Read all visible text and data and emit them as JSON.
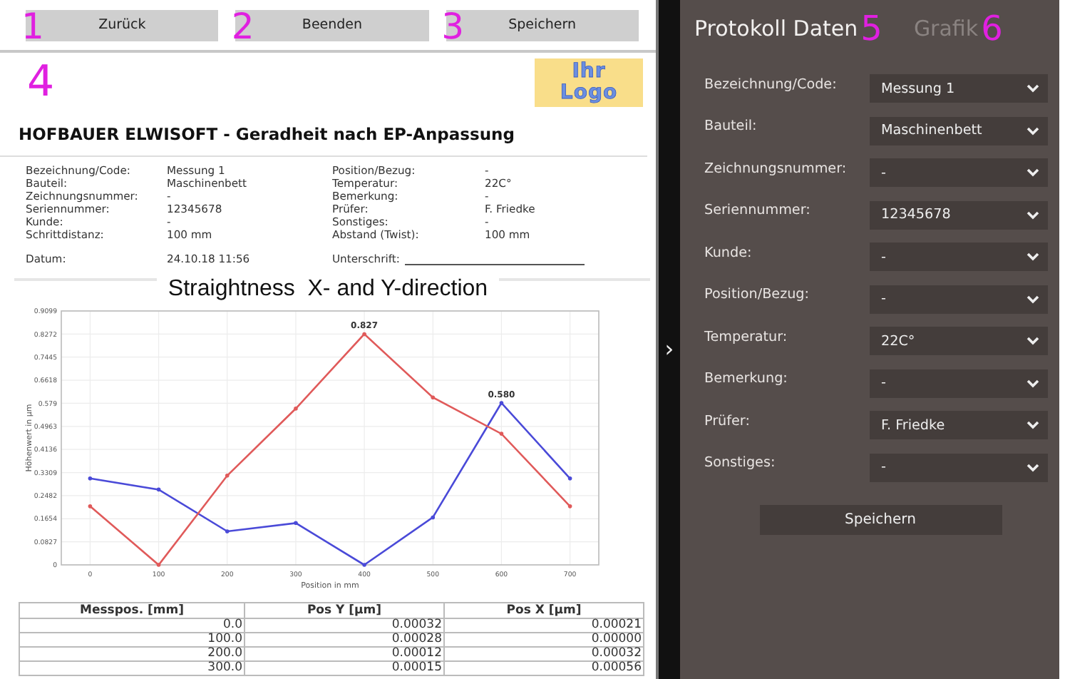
{
  "toolbar": {
    "buttons": [
      {
        "callout": "1",
        "label": "Zurück"
      },
      {
        "callout": "2",
        "label": "Beenden"
      },
      {
        "callout": "3",
        "label": "Speichern"
      }
    ]
  },
  "report": {
    "callout": "4",
    "logo": {
      "line_1": "Ihr",
      "line_2": "Logo"
    },
    "title": "HOFBAUER ELWISOFT - Geradheit nach EP-Anpassung",
    "fields_left": [
      {
        "label": "Bezeichnung/Code:",
        "value": "Messung 1"
      },
      {
        "label": "Bauteil:",
        "value": "Maschinenbett"
      },
      {
        "label": "Zeichnungsnummer:",
        "value": "-"
      },
      {
        "label": "Seriennummer:",
        "value": "12345678"
      },
      {
        "label": "Kunde:",
        "value": "-"
      },
      {
        "label": "Schrittdistanz:",
        "value": "100 mm"
      }
    ],
    "fields_right": [
      {
        "label": "Position/Bezug:",
        "value": "-"
      },
      {
        "label": "Temperatur:",
        "value": "22C°"
      },
      {
        "label": "Bemerkung:",
        "value": "-"
      },
      {
        "label": "Prüfer:",
        "value": "F. Friedke"
      },
      {
        "label": "Sonstiges:",
        "value": "-"
      },
      {
        "label": "Abstand (Twist):",
        "value": "100 mm"
      }
    ],
    "date": {
      "label": "Datum:",
      "value": "24.10.18 11:56"
    },
    "signature": {
      "label": "Unterschrift:"
    },
    "chart": {
      "chart_data": {
        "type": "line",
        "title": "Straightness  X- and Y-direction",
        "xlabel": "Position in mm",
        "ylabel": "Höhenwert in µm",
        "x": [
          0,
          100,
          200,
          300,
          400,
          500,
          600,
          700
        ],
        "series": [
          {
            "color": "#4a4ad8",
            "values": [
              0.31,
              0.27,
              0.12,
              0.15,
              0,
              0.17,
              0.58,
              0.31
            ]
          },
          {
            "color": "#e05a5a",
            "values": [
              0.21,
              0,
              0.32,
              0.56,
              0.827,
              0.6,
              0.47,
              0.21
            ]
          }
        ],
        "grid": true,
        "xlim": [
          -42,
          742
        ],
        "ylim": [
          0,
          0.9099
        ],
        "xticks": [
          0,
          100,
          200,
          300,
          400,
          500,
          600,
          700
        ],
        "yticks": [
          0,
          0.0827,
          0.1654,
          0.2482,
          0.3309,
          0.4136,
          0.4963,
          0.579,
          0.6618,
          0.7445,
          0.8272,
          0.9099
        ],
        "annotations": [
          {
            "x": 400,
            "y": 0.827,
            "text": "0.827"
          },
          {
            "x": 600,
            "y": 0.58,
            "text": "0.580"
          }
        ]
      }
    },
    "table": {
      "columns": [
        "Messpos. [mm]",
        "Pos Y [µm]",
        "Pos X [µm]"
      ],
      "rows": [
        [
          "0.0",
          "0.00032",
          "0.00021"
        ],
        [
          "100.0",
          "0.00028",
          "0.00000"
        ],
        [
          "200.0",
          "0.00012",
          "0.00032"
        ],
        [
          "300.0",
          "0.00015",
          "0.00056"
        ]
      ]
    }
  },
  "side_panel": {
    "toggle": "›",
    "tabs": [
      {
        "label": "Protokoll Daten",
        "callout": "5",
        "selected": true
      },
      {
        "label": "Grafik",
        "callout": "6",
        "selected": false
      }
    ],
    "fields": [
      {
        "label": "Bezeichnung/Code:",
        "value": "Messung 1"
      },
      {
        "label": "Bauteil:",
        "value": "Maschinenbett"
      },
      {
        "label": "Zeichnungsnummer:",
        "value": "-"
      },
      {
        "label": "Seriennummer:",
        "value": "12345678"
      },
      {
        "label": "Kunde:",
        "value": "-"
      },
      {
        "label": "Position/Bezug:",
        "value": "-"
      },
      {
        "label": "Temperatur:",
        "value": "22C°"
      },
      {
        "label": "Bemerkung:",
        "value": "-"
      },
      {
        "label": "Prüfer:",
        "value": "F. Friedke"
      },
      {
        "label": "Sonstiges:",
        "value": "-"
      }
    ],
    "save_button": "Speichern"
  }
}
